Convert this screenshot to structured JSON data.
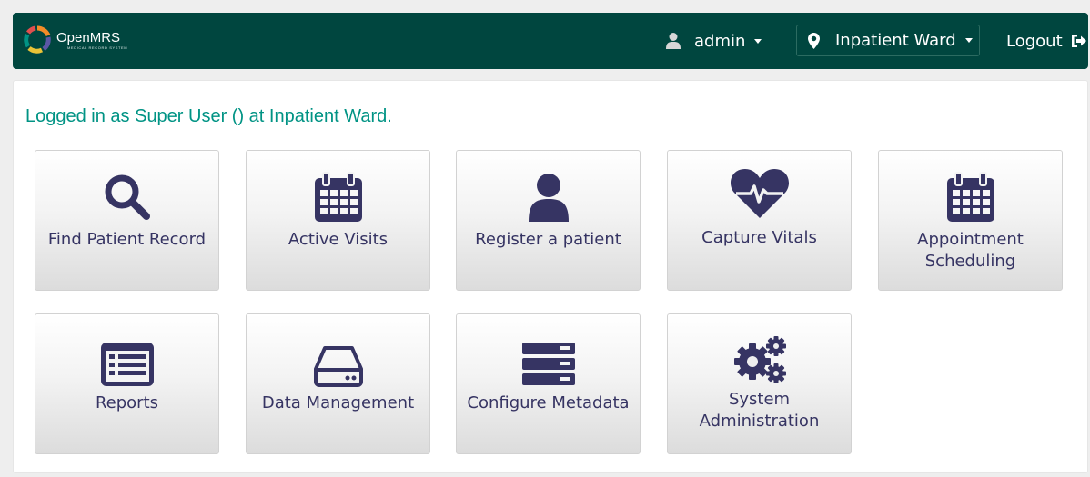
{
  "header": {
    "logo_name": "OpenMRS",
    "logo_subtitle": "MEDICAL RECORD SYSTEM",
    "user": {
      "label": "admin",
      "icon": "user-icon"
    },
    "location": {
      "label": "Inpatient Ward",
      "icon": "map-marker-icon"
    },
    "logout": {
      "label": "Logout",
      "icon": "sign-out-icon"
    },
    "colors": {
      "background": "#00463f",
      "text": "#ffffff"
    }
  },
  "main": {
    "login_message": "Logged in as Super User () at Inpatient Ward.",
    "colors": {
      "message": "#009384",
      "tile_text": "#363463",
      "icon": "#363463"
    },
    "apps": [
      {
        "label": "Find Patient Record",
        "icon": "search-icon"
      },
      {
        "label": "Active Visits",
        "icon": "calendar-icon"
      },
      {
        "label": "Register a patient",
        "icon": "user-icon"
      },
      {
        "label": "Capture Vitals",
        "icon": "heartbeat-icon"
      },
      {
        "label": "Appointment Scheduling",
        "icon": "calendar-icon"
      },
      {
        "label": "Reports",
        "icon": "list-alt-icon"
      },
      {
        "label": "Data Management",
        "icon": "hdd-icon"
      },
      {
        "label": "Configure Metadata",
        "icon": "server-icon"
      },
      {
        "label": "System Administration",
        "icon": "cogs-icon"
      }
    ]
  }
}
